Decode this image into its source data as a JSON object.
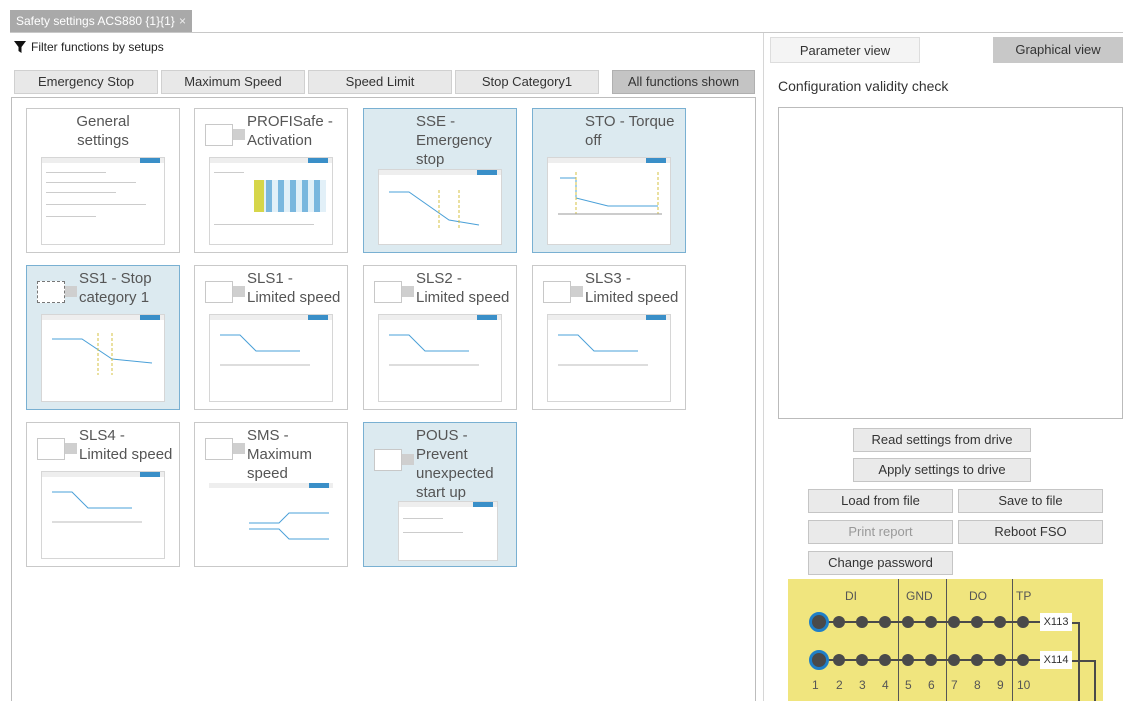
{
  "window": {
    "tab_title": "Safety settings ACS880 {1}{1}",
    "close_glyph": "×"
  },
  "filter": {
    "label": "Filter functions by setups",
    "icon": "filter-icon"
  },
  "filter_buttons": [
    "Emergency Stop",
    "Maximum Speed",
    "Speed Limit",
    "Stop Category1",
    "All functions shown"
  ],
  "tiles": [
    {
      "l1": "General",
      "l2": "settings",
      "l3": "",
      "selected": false,
      "checkbox": false
    },
    {
      "l1": "PROFISafe -",
      "l2": "Activation",
      "l3": "",
      "selected": false,
      "checkbox": true
    },
    {
      "l1": "SSE -",
      "l2": "Emergency",
      "l3": "stop",
      "selected": true,
      "checkbox": false
    },
    {
      "l1": "STO - Torque",
      "l2": "off",
      "l3": "",
      "selected": true,
      "checkbox": false
    },
    {
      "l1": "SS1 - Stop",
      "l2": "category 1",
      "l3": "",
      "selected": true,
      "checkbox": true
    },
    {
      "l1": "SLS1 -",
      "l2": "Limited speed",
      "l3": "",
      "selected": false,
      "checkbox": true
    },
    {
      "l1": "SLS2 -",
      "l2": "Limited speed",
      "l3": "",
      "selected": false,
      "checkbox": true
    },
    {
      "l1": "SLS3 -",
      "l2": "Limited speed",
      "l3": "",
      "selected": false,
      "checkbox": true
    },
    {
      "l1": "SLS4 -",
      "l2": "Limited speed",
      "l3": "",
      "selected": false,
      "checkbox": true
    },
    {
      "l1": "SMS -",
      "l2": "Maximum",
      "l3": "speed",
      "selected": false,
      "checkbox": true
    },
    {
      "l1": "POUS -",
      "l2": "Prevent",
      "l3": "unexpected",
      "l4": "start up",
      "selected": true,
      "checkbox": true
    }
  ],
  "right": {
    "tab_parameter": "Parameter view",
    "tab_graphical": "Graphical view",
    "validity_title": "Configuration validity check",
    "read_settings": "Read settings from drive",
    "apply_settings": "Apply settings to drive",
    "load_file": "Load from file",
    "save_file": "Save to file",
    "print_report": "Print report",
    "reboot": "Reboot FSO",
    "change_password": "Change password"
  },
  "terminal": {
    "groups": [
      "DI",
      "GND",
      "DO",
      "TP"
    ],
    "numbers": [
      "1",
      "2",
      "3",
      "4",
      "5",
      "6",
      "7",
      "8",
      "9",
      "10"
    ],
    "connectors": [
      "X113",
      "X114"
    ],
    "color": "#f0e57e",
    "highlight_color": "#1f7fc8"
  }
}
